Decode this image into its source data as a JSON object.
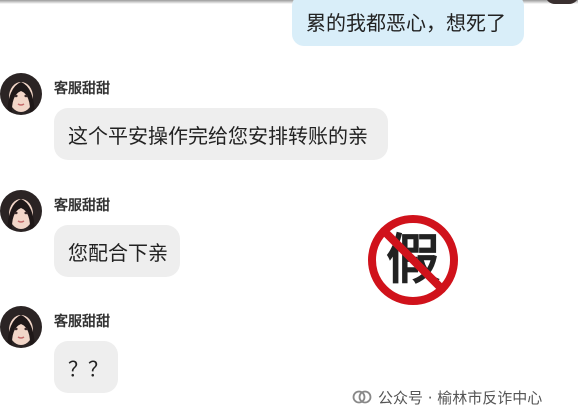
{
  "conversation": {
    "outgoing_message": "累的我都恶心，想死了",
    "messages": [
      {
        "sender": "客服甜甜",
        "text": "这个平安操作完给您安排转账的亲"
      },
      {
        "sender": "客服甜甜",
        "text": "您配合下亲"
      },
      {
        "sender": "客服甜甜",
        "text": "？？"
      }
    ]
  },
  "stamp": {
    "label": "假",
    "color": "#d0121b"
  },
  "watermark": {
    "icon": "wechat-official-account-icon",
    "text": "公众号 · 榆林市反诈中心"
  },
  "colors": {
    "outgoing_bubble": "#d9eef9",
    "incoming_bubble": "#eeeeee"
  }
}
